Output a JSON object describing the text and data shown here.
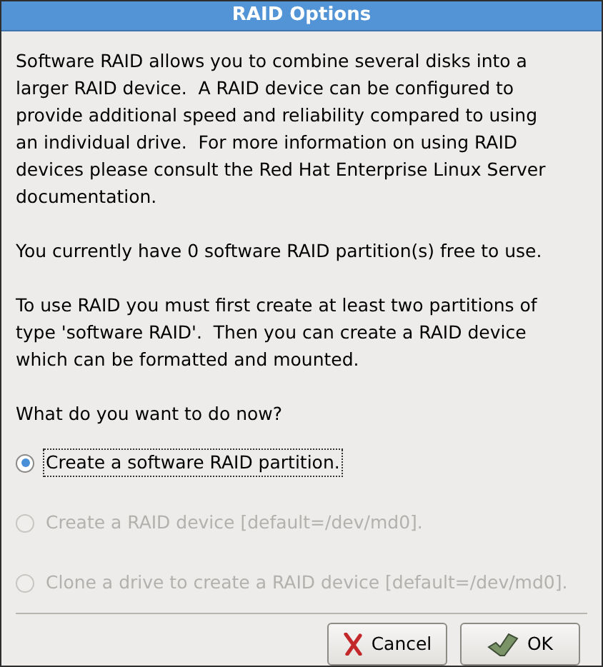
{
  "window": {
    "title": "RAID Options"
  },
  "paragraphs": [
    "Software RAID allows you to combine several disks into a\nlarger RAID device.  A RAID device can be configured to\nprovide additional speed and reliability compared to using\nan individual drive.  For more information on using RAID\ndevices please consult the Red Hat Enterprise Linux Server\ndocumentation.",
    "You currently have 0 software RAID partition(s) free to use.",
    "To use RAID you must first create at least two partitions of\ntype 'software RAID'.  Then you can create a RAID device\nwhich can be formatted and mounted.",
    "What do you want to do now?"
  ],
  "options": [
    {
      "label": "Create a software RAID partition.",
      "selected": true,
      "disabled": false,
      "focused": true
    },
    {
      "label": "Create a RAID device [default=/dev/md0].",
      "selected": false,
      "disabled": true,
      "focused": false
    },
    {
      "label": "Clone a drive to create a RAID device [default=/dev/md0].",
      "selected": false,
      "disabled": true,
      "focused": false
    }
  ],
  "buttons": [
    {
      "label": "Cancel",
      "kind": "cancel"
    },
    {
      "label": "OK",
      "kind": "ok"
    }
  ]
}
